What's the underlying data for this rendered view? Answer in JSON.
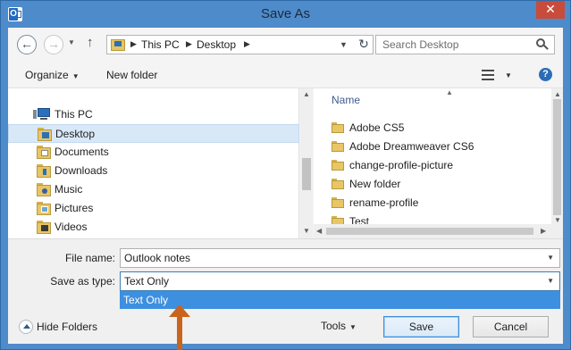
{
  "window": {
    "title": "Save As",
    "close_glyph": "✕"
  },
  "address": {
    "crumbs": [
      "This PC",
      "Desktop"
    ],
    "search_placeholder": "Search Desktop"
  },
  "toolbar": {
    "organize": "Organize",
    "new_folder": "New folder",
    "help": "?"
  },
  "nav": {
    "items": [
      {
        "label": "This PC",
        "icon": "pc-icon"
      },
      {
        "label": "Desktop",
        "icon": "desktop-folder-icon",
        "selected": true
      },
      {
        "label": "Documents",
        "icon": "documents-folder-icon"
      },
      {
        "label": "Downloads",
        "icon": "downloads-folder-icon"
      },
      {
        "label": "Music",
        "icon": "music-folder-icon"
      },
      {
        "label": "Pictures",
        "icon": "pictures-folder-icon"
      },
      {
        "label": "Videos",
        "icon": "videos-folder-icon"
      }
    ]
  },
  "files": {
    "column_name": "Name",
    "items": [
      "Adobe CS5",
      "Adobe Dreamweaver CS6",
      "change-profile-picture",
      "New folder",
      "rename-profile",
      "Test"
    ]
  },
  "form": {
    "file_name_label": "File name:",
    "file_name_value": "Outlook notes",
    "save_type_label": "Save as type:",
    "save_type_value": "Text Only",
    "save_type_options": [
      "Text Only"
    ]
  },
  "footer": {
    "hide_folders": "Hide Folders",
    "tools": "Tools",
    "save": "Save",
    "cancel": "Cancel"
  },
  "colors": {
    "title_bar": "#4e8bcb",
    "selection": "#3d8fe0",
    "annotation_arrow": "#c8641e"
  }
}
